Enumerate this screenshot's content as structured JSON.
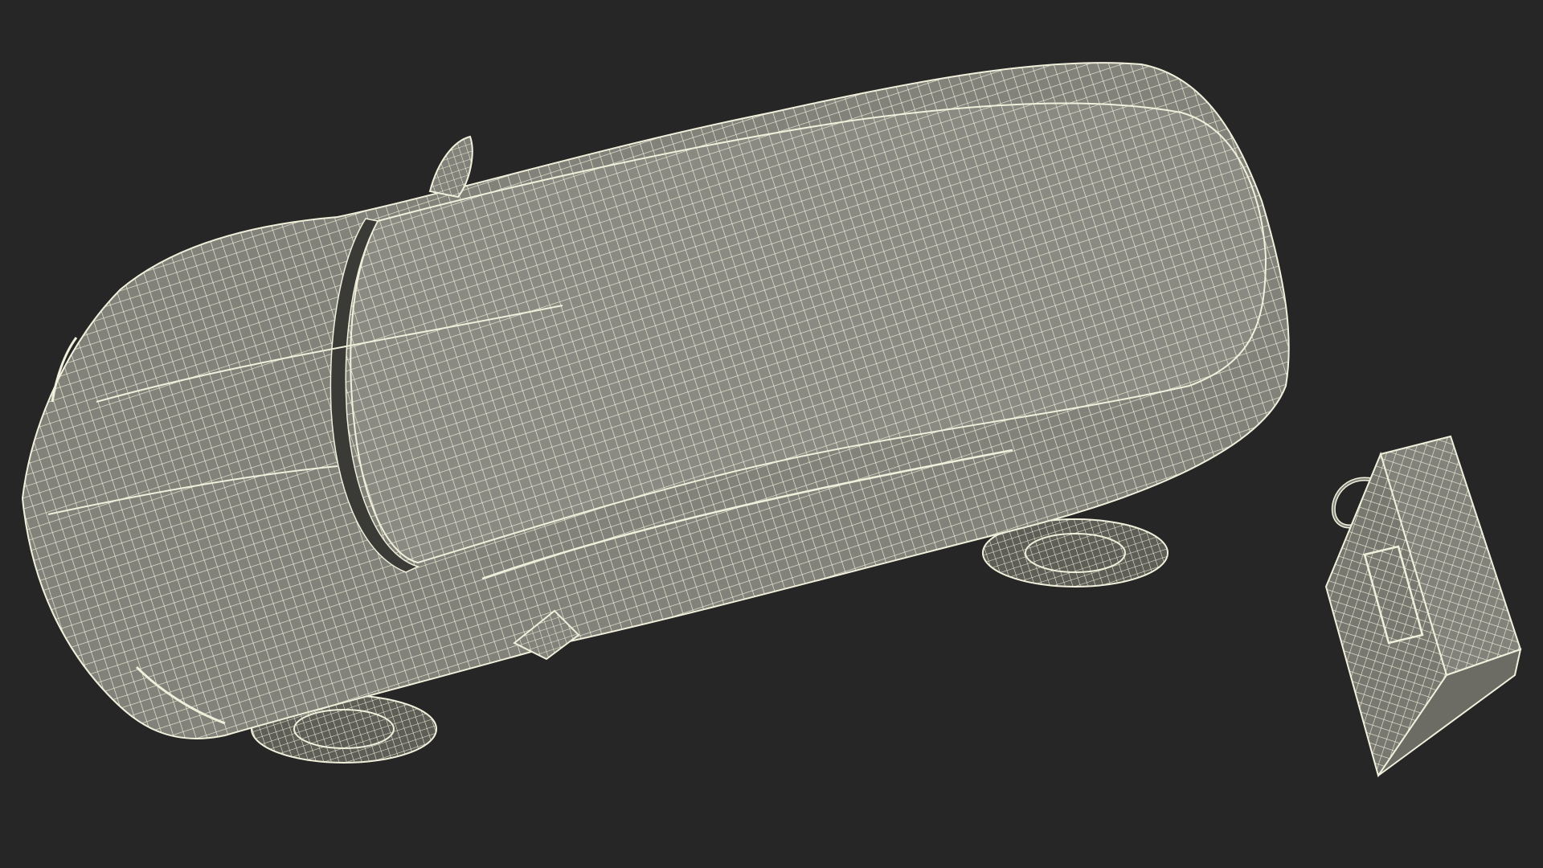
{
  "scene": {
    "background_color": "#262626",
    "surface_color": "#82827a",
    "surface_dark_color": "#5e5e57",
    "wire_color": "#f0f0dc",
    "objects": [
      {
        "name": "car-wireframe-model",
        "kind": "3D wireframe car, top-down view"
      },
      {
        "name": "wall-charger-wireframe-model",
        "kind": "3D wireframe charging unit box with cable"
      }
    ]
  }
}
